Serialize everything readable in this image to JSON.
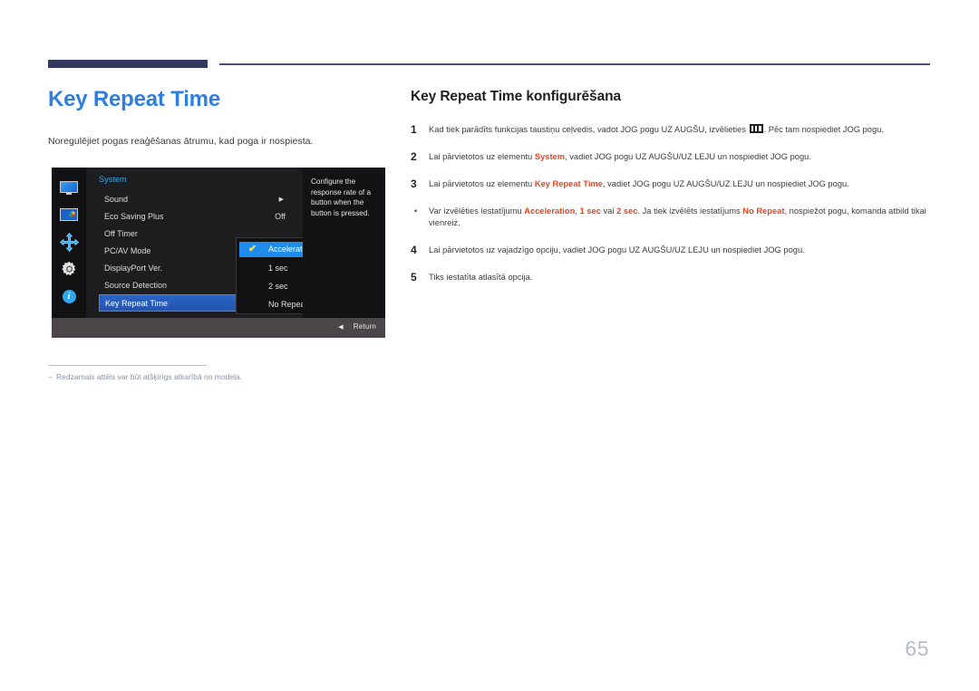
{
  "page": {
    "number": "65"
  },
  "left": {
    "title": "Key Repeat Time",
    "lead": "Noregulējiet pogas reaģēšanas ātrumu, kad poga ir nospiesta.",
    "footnote_dash": "‒",
    "footnote": "Redzamais attēls var būt atšķirīgs atkarībā no modeļa."
  },
  "osd": {
    "rail_icons": [
      "monitor-icon",
      "picture-icon",
      "arrows-icon",
      "gear-icon",
      "info-icon"
    ],
    "menu_title": "System",
    "menu_rows": [
      {
        "label": "Sound",
        "value": "",
        "arrow": "▶"
      },
      {
        "label": "Eco Saving Plus",
        "value": "Off",
        "arrow": ""
      },
      {
        "label": "Off Timer",
        "value": "",
        "arrow": ""
      },
      {
        "label": "PC/AV Mode",
        "value": "",
        "arrow": ""
      },
      {
        "label": "DisplayPort Ver.",
        "value": "",
        "arrow": ""
      },
      {
        "label": "Source Detection",
        "value": "",
        "arrow": ""
      },
      {
        "label": "Key Repeat Time",
        "value": "",
        "arrow": ""
      }
    ],
    "selected_row_index": 6,
    "submenu": {
      "options": [
        "Acceleration",
        "1 sec",
        "2 sec",
        "No Repeat"
      ],
      "selected": "Acceleration",
      "check_glyph": "✔"
    },
    "help_text": "Configure the response rate of a button when the button is pressed.",
    "return_label": "Return",
    "return_icon": "◀"
  },
  "right": {
    "title": "Key Repeat Time konfigurēšana",
    "steps": [
      {
        "marker": "1",
        "type": "number",
        "parts": [
          {
            "t": "Kad tiek parādīts funkcijas taustiņu ceļvedis, vadot JOG pogu UZ AUGŠU, izvēlieties ",
            "s": "plain"
          },
          {
            "t": "",
            "s": "menu-glyph"
          },
          {
            "t": ". Pēc tam nospiediet JOG pogu.",
            "s": "plain"
          }
        ]
      },
      {
        "marker": "2",
        "type": "number",
        "parts": [
          {
            "t": "Lai pārvietotos uz elementu ",
            "s": "plain"
          },
          {
            "t": "System",
            "s": "hl"
          },
          {
            "t": ", vadiet JOG pogu UZ AUGŠU/UZ LEJU un nospiediet JOG pogu.",
            "s": "plain"
          }
        ]
      },
      {
        "marker": "3",
        "type": "number",
        "parts": [
          {
            "t": "Lai pārvietotos uz elementu ",
            "s": "plain"
          },
          {
            "t": "Key Repeat Time",
            "s": "hl"
          },
          {
            "t": ", vadiet JOG pogu UZ AUGŠU/UZ LEJU un nospiediet JOG pogu.",
            "s": "plain"
          }
        ]
      },
      {
        "marker": "•",
        "type": "bullet",
        "parts": [
          {
            "t": "Var izvēlēties iestatījumu ",
            "s": "plain"
          },
          {
            "t": "Acceleration",
            "s": "hl"
          },
          {
            "t": ", ",
            "s": "plain"
          },
          {
            "t": "1 sec",
            "s": "hl"
          },
          {
            "t": " vai ",
            "s": "plain"
          },
          {
            "t": "2 sec",
            "s": "hl"
          },
          {
            "t": ". Ja tiek izvēlēts iestatījums ",
            "s": "plain"
          },
          {
            "t": "No Repeat",
            "s": "hl"
          },
          {
            "t": ", nospiežot pogu, komanda atbild tikai vienreiz.",
            "s": "plain"
          }
        ]
      },
      {
        "marker": "4",
        "type": "number",
        "parts": [
          {
            "t": "Lai pārvietotos uz vajadzīgo opciju, vadiet JOG pogu UZ AUGŠU/UZ LEJU un nospiediet JOG pogu.",
            "s": "plain"
          }
        ]
      },
      {
        "marker": "5",
        "type": "number",
        "parts": [
          {
            "t": "Tiks iestatīta atlasītā opcija.",
            "s": "plain"
          }
        ]
      }
    ]
  },
  "colors": {
    "title_blue": "#2f7fe0",
    "highlight_red": "#e8441e",
    "rule_navy": "#343a5e",
    "osd_select_blue": "#1f8bea",
    "page_num_gray": "#b6bac9"
  }
}
